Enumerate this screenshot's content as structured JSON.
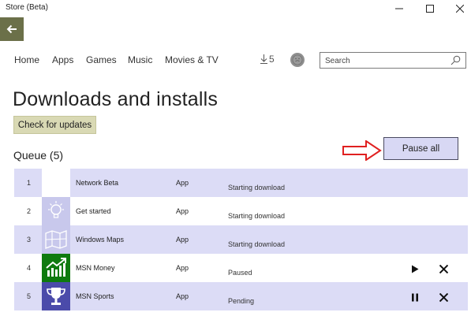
{
  "window": {
    "title": "Store (Beta)",
    "minimize_icon": "minimize-icon",
    "maximize_icon": "maximize-icon",
    "close_icon": "close-icon"
  },
  "back_button": {
    "icon": "back-arrow-icon"
  },
  "nav": {
    "items": [
      {
        "label": "Home"
      },
      {
        "label": "Apps"
      },
      {
        "label": "Games"
      },
      {
        "label": "Music"
      },
      {
        "label": "Movies & TV"
      }
    ],
    "downloads_count": "5",
    "downloads_icon": "download-icon",
    "avatar_icon": "user-avatar-icon",
    "search": {
      "placeholder": "Search",
      "value": "",
      "icon": "search-icon"
    }
  },
  "page": {
    "title": "Downloads and installs",
    "check_updates_label": "Check for updates",
    "queue_heading": "Queue (5)",
    "pause_all_label": "Pause all"
  },
  "annotation": {
    "icon": "red-arrow-icon",
    "color": "#e02020"
  },
  "queue": [
    {
      "num": "1",
      "name": "Network Beta",
      "type": "App",
      "status": "Starting download",
      "icon": "blank-tile-icon"
    },
    {
      "num": "2",
      "name": "Get started",
      "type": "App",
      "status": "Starting download",
      "icon": "lightbulb-icon"
    },
    {
      "num": "3",
      "name": "Windows Maps",
      "type": "App",
      "status": "Starting download",
      "icon": "map-icon"
    },
    {
      "num": "4",
      "name": "MSN Money",
      "type": "App",
      "status": "Paused",
      "icon": "chart-icon",
      "actions": [
        "play-icon",
        "close-icon"
      ]
    },
    {
      "num": "5",
      "name": "MSN Sports",
      "type": "App",
      "status": "Pending",
      "icon": "trophy-icon",
      "actions": [
        "pause-icon",
        "close-icon"
      ]
    }
  ],
  "colors": {
    "row_shade": "#dcdcf6",
    "pause_all_bg": "#d8d8f4",
    "check_updates_bg": "#d9d9b4",
    "back_button_bg": "#6b7049",
    "money_tile": "#0e7a0e",
    "sports_tile": "#4b4baa"
  }
}
